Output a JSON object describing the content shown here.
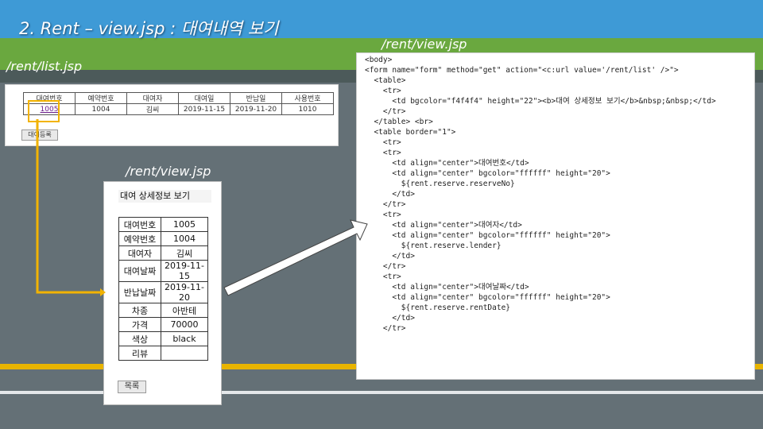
{
  "slide": {
    "title": "2. Rent – view.jsp : 대여내역 보기"
  },
  "labels": {
    "list_jsp": "/rent/list.jsp",
    "view_jsp_left": "/rent/view.jsp",
    "view_jsp_right": "/rent/view.jsp"
  },
  "list_page": {
    "headers": [
      "대여번호",
      "예약번호",
      "대여자",
      "대여일",
      "반납일",
      "사용번호"
    ],
    "row": [
      "1005",
      "1004",
      "김씨",
      "2019-11-15",
      "2019-11-20",
      "1010"
    ],
    "register_button": "대여등록"
  },
  "view_page": {
    "heading": "대여 상세정보 보기",
    "rows": [
      {
        "key": "대여번호",
        "value": "1005"
      },
      {
        "key": "예약번호",
        "value": "1004"
      },
      {
        "key": "대여자",
        "value": "김씨"
      },
      {
        "key": "대여날짜",
        "value": "2019-11-15"
      },
      {
        "key": "반납날짜",
        "value": "2019-11-20"
      },
      {
        "key": "차종",
        "value": "아반테"
      },
      {
        "key": "가격",
        "value": "70000"
      },
      {
        "key": "색상",
        "value": "black"
      },
      {
        "key": "리뷰",
        "value": ""
      }
    ],
    "list_button": "목록"
  },
  "code_lines": [
    "<body>",
    "<form name=\"form\" method=\"get\" action=\"<c:url value='/rent/list' />\">",
    "  <table>",
    "    <tr>",
    "      <td bgcolor=\"f4f4f4\" height=\"22\"><b>대여 상세정보 보기</b>&nbsp;&nbsp;</td>",
    "    </tr>",
    "  </table> <br>",
    "  <table border=\"1\">",
    "    <tr>",
    "    <tr>",
    "      <td align=\"center\">대여번호</td>",
    "      <td align=\"center\" bgcolor=\"ffffff\" height=\"20\">",
    "        ${rent.reserve.reserveNo}",
    "      </td>",
    "    </tr>",
    "    <tr>",
    "      <td align=\"center\">대여자</td>",
    "      <td align=\"center\" bgcolor=\"ffffff\" height=\"20\">",
    "        ${rent.reserve.lender}",
    "      </td>",
    "    </tr>",
    "    <tr>",
    "      <td align=\"center\">대여날짜</td>",
    "      <td align=\"center\" bgcolor=\"ffffff\" height=\"20\">",
    "        ${rent.reserve.rentDate}",
    "      </td>",
    "    </tr>"
  ],
  "colors": {
    "sky": "#3e9ad6",
    "grass": "#6aa83f",
    "road": "#647076",
    "highlight": "#f2b300"
  }
}
